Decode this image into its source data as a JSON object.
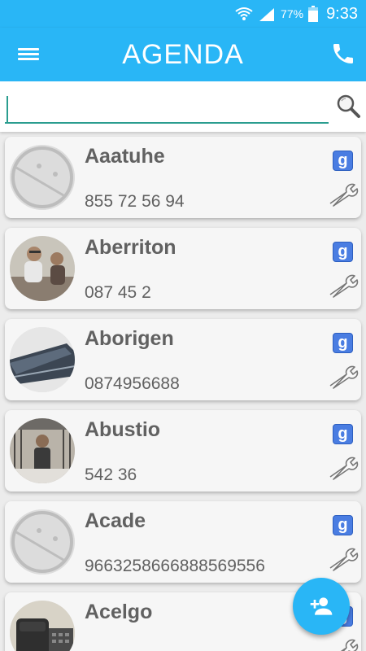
{
  "status_bar": {
    "battery_percent": "77%",
    "time": "9:33",
    "icons": [
      "wifi-icon",
      "signal-icon",
      "battery-icon"
    ]
  },
  "app_bar": {
    "title": "AGENDA",
    "left_icon": "menu-icon",
    "right_icon": "phone-icon"
  },
  "search": {
    "value": "",
    "placeholder": "",
    "icon": "search-icon"
  },
  "colors": {
    "primary": "#29b6f6",
    "accent": "#2a9d8f",
    "card_bg": "#f6f6f6",
    "text": "#616161",
    "google_badge": "#4a7de2"
  },
  "contacts": [
    {
      "name": "Aaatuhe",
      "phone": "855 72 56 94",
      "avatar": "placeholder-avatar",
      "account": "g"
    },
    {
      "name": "Aberriton",
      "phone": "087 45 2",
      "avatar": "photo-people",
      "account": "g"
    },
    {
      "name": "Aborigen",
      "phone": "0874956688",
      "avatar": "photo-laptop",
      "account": "g"
    },
    {
      "name": "Abustio",
      "phone": "542 36",
      "avatar": "photo-person-stairs",
      "account": "g"
    },
    {
      "name": "Acade",
      "phone": "9663258666888569556",
      "avatar": "placeholder-avatar",
      "account": "g"
    },
    {
      "name": "Acelgo",
      "phone": "",
      "avatar": "photo-telephone",
      "account": "g"
    }
  ],
  "fab": {
    "icon": "add-contact-icon"
  }
}
